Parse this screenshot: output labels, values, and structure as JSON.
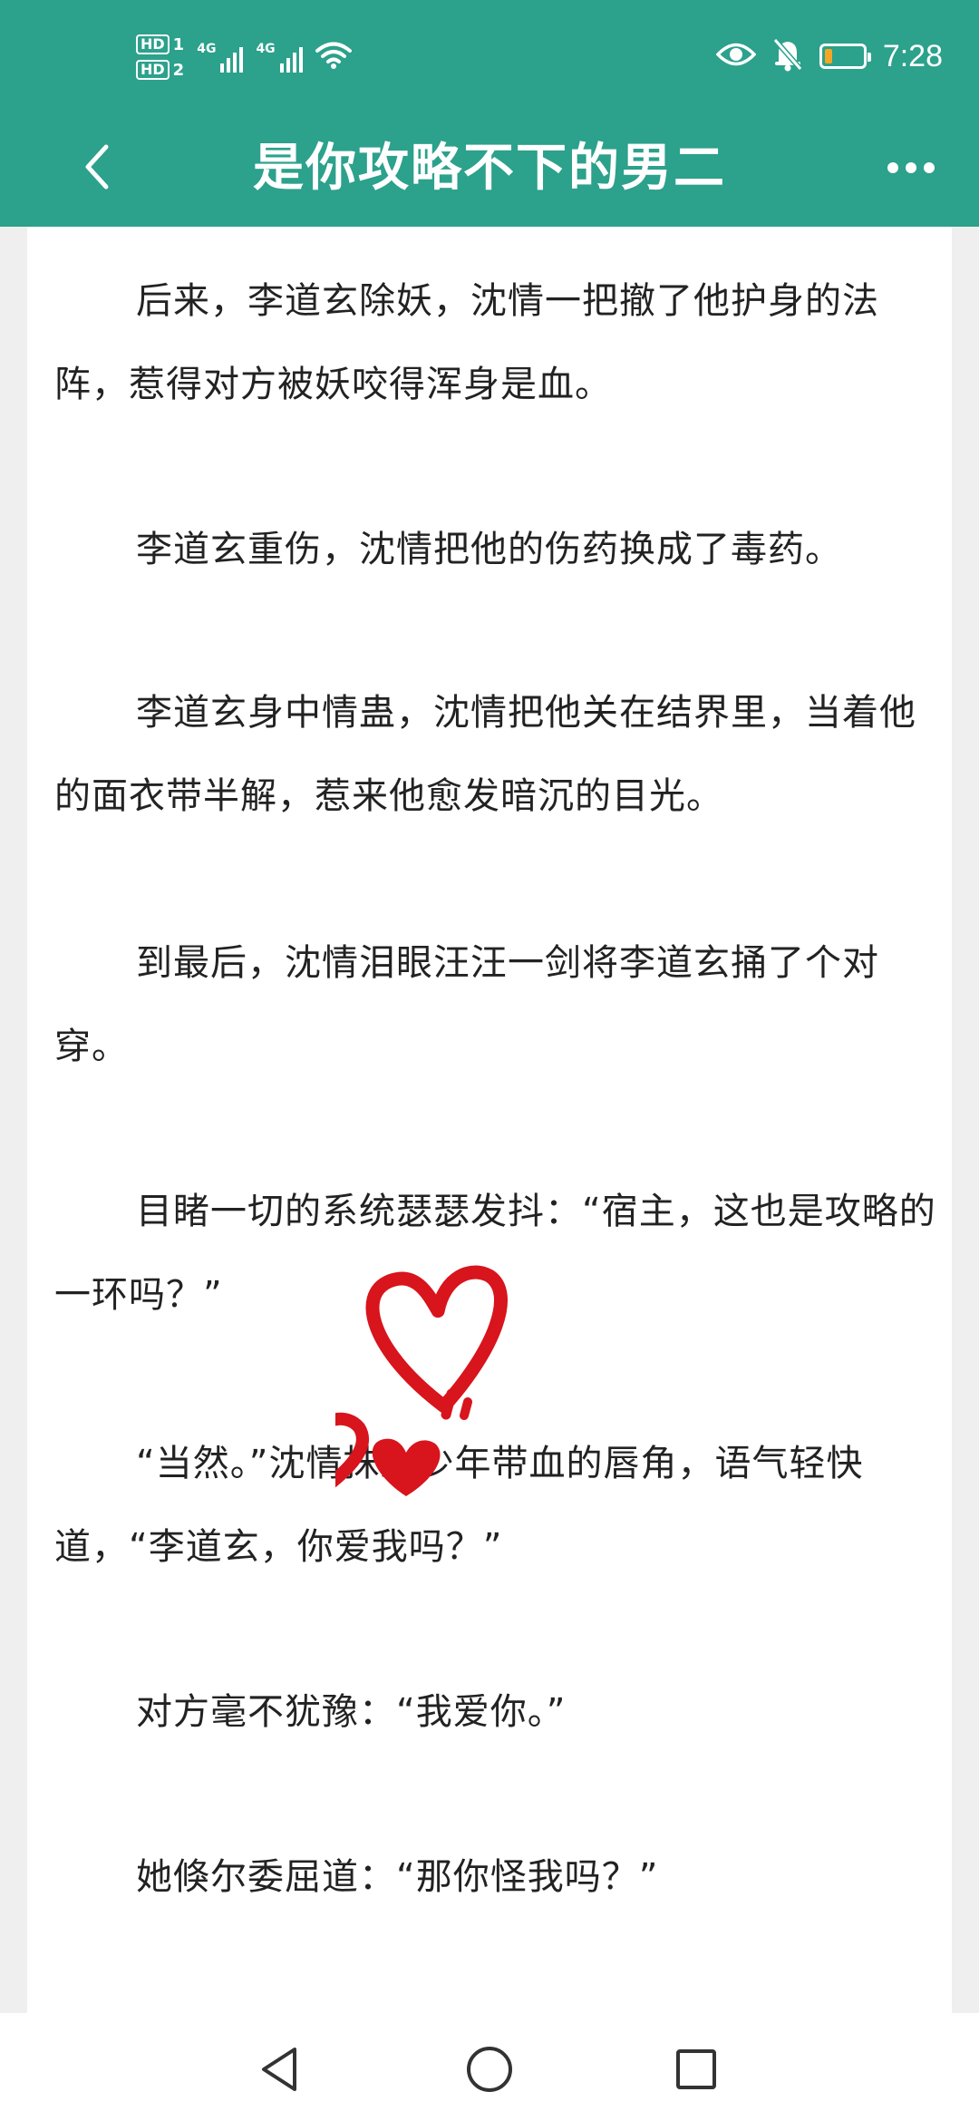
{
  "status_bar": {
    "sim1_label": "HD",
    "sim1_slot": "1",
    "sim2_label": "HD",
    "sim2_slot": "2",
    "network1": "4G",
    "network2": "4G",
    "time": "7:28",
    "battery_level": 0.2,
    "icons": [
      "wifi-icon",
      "eye-icon",
      "bell-off-icon",
      "battery-icon"
    ]
  },
  "toolbar": {
    "title": "是你攻略不下的男二",
    "back_icon": "chevron-left-icon",
    "more_icon": "more-dots-icon"
  },
  "content": {
    "paragraphs": [
      "后来，李道玄除妖，沈情一把撤了他护身的法阵，惹得对方被妖咬得浑身是血。",
      "李道玄重伤，沈情把他的伤药换成了毒药。",
      "李道玄身中情蛊，沈情把他关在结界里，当着他的面衣带半解，惹来他愈发暗沉的目光。",
      "到最后，沈情泪眼汪汪一剑将李道玄捅了个对穿。",
      "目睹一切的系统瑟瑟发抖：“宿主，这也是攻略的一环吗？”",
      "“当然。”沈情抹上少年带血的唇角，语气轻快道，“李道玄，你爱我吗？”",
      "对方毫不犹豫：“我爱你。”",
      "她倏尔委屈道：“那你怪我吗？”"
    ]
  },
  "decoration": {
    "sticker": "red-hearts-sticker",
    "color": "#d8141c"
  },
  "nav_bar": {
    "icons": [
      "back-triangle-icon",
      "home-circle-icon",
      "recents-square-icon"
    ]
  },
  "colors": {
    "header": "#2ca18c",
    "text": "#222222",
    "background": "#efefef"
  }
}
